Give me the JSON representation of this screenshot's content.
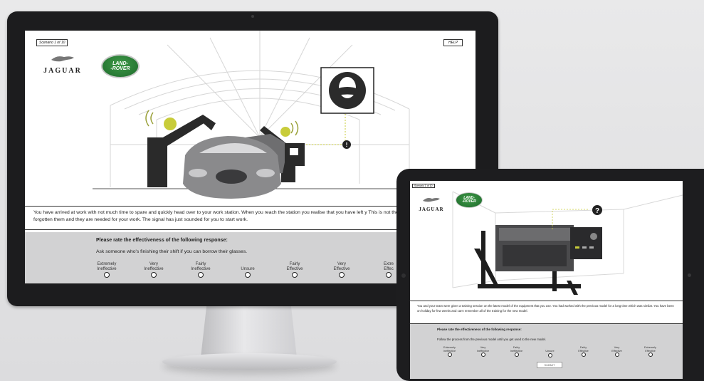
{
  "monitor": {
    "scenario_tag": "Scenario 1 of 10",
    "help_label": "HELP",
    "jaguar_logo": "JAGUAR",
    "landrover_logo": {
      "line1": "LAND-",
      "line2": "-ROVER"
    },
    "goggles_sign_icon": "safety-goggles-icon",
    "description": "You have arrived at work with not much time to spare and quickly head over to your work station. When you reach the station you realise that you have left y This is not the first time that you have forgotten them and they are needed for your work. The signal has just sounded for you to start work.",
    "rating_prompt": "Please rate the effectiveness of the following response:",
    "response": "Ask someone who's finishing their shift if you can borrow their glasses.",
    "options": [
      {
        "l1": "Extremely",
        "l2": "Ineffective"
      },
      {
        "l1": "Very",
        "l2": "Ineffective"
      },
      {
        "l1": "Fairly",
        "l2": "Ineffective"
      },
      {
        "l1": "",
        "l2": "Unsure"
      },
      {
        "l1": "Fairly",
        "l2": "Effective"
      },
      {
        "l1": "Very",
        "l2": "Effective"
      },
      {
        "l1": "Extre",
        "l2": "Effec"
      }
    ]
  },
  "tablet": {
    "scenario_tag": "Scenario 1 of 10",
    "jaguar_logo": "JAGUAR",
    "landrover_logo": {
      "line1": "LAND-",
      "line2": "-ROVER"
    },
    "question_icon": "?",
    "description": "You and your team were given a training session on the latest model of the equipment that you use. You had worked with the previous model for a long time which was similar. You have been on holiday for few weeks and can't remember all of the training for the new model.",
    "rating_prompt": "Please rate the effectiveness of the following response:",
    "response": "Follow the process from the previous model until you get used to the new model.",
    "options": [
      {
        "l1": "Extremely",
        "l2": "Ineffective"
      },
      {
        "l1": "Very",
        "l2": "Ineffective"
      },
      {
        "l1": "Fairly",
        "l2": "Ineffective"
      },
      {
        "l1": "",
        "l2": "Unsure"
      },
      {
        "l1": "Fairly",
        "l2": "Effective"
      },
      {
        "l1": "Very",
        "l2": "Effective"
      },
      {
        "l1": "Extremely",
        "l2": "Effective"
      }
    ],
    "submit_label": "SUBMIT"
  },
  "colors": {
    "bezel": "#1c1c1e",
    "rating_bg": "#d2d2d3",
    "landrover_green": "#2e7d3a",
    "sign_dark": "#2b2b2b"
  }
}
